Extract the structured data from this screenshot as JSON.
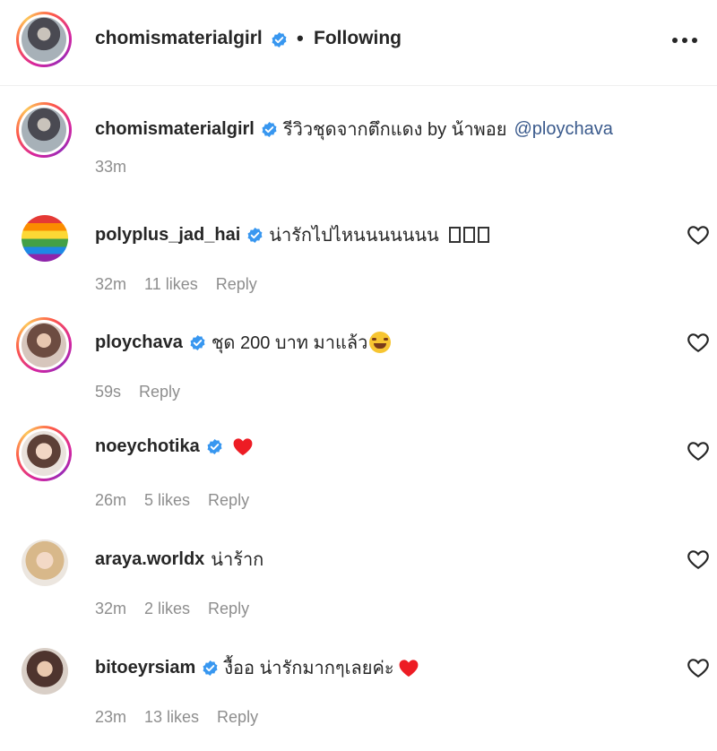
{
  "header": {
    "username": "chomismaterialgirl",
    "separator": "•",
    "follow_status": "Following"
  },
  "caption": {
    "username": "chomismaterialgirl",
    "text": "รีวิวชุดจากตึกแดง by น้าพอย",
    "mention": "@ploychava",
    "time": "33m"
  },
  "comments": [
    {
      "username": "polyplus_jad_hai",
      "verified": true,
      "text": "น่ารักไปไหนนนนนนน",
      "emoji": "tofu-glyphs",
      "time": "32m",
      "likes": "11 likes",
      "reply": "Reply"
    },
    {
      "username": "ploychava",
      "verified": true,
      "text": "ชุด 200 บาท มาแล้ว",
      "emoji": "grin-sweat-emoji",
      "time": "59s",
      "likes": "",
      "reply": "Reply"
    },
    {
      "username": "noeychotika",
      "verified": true,
      "text": "",
      "emoji": "red-heart-emoji",
      "time": "26m",
      "likes": "5 likes",
      "reply": "Reply"
    },
    {
      "username": "araya.worldx",
      "verified": false,
      "text": "น่าร้าก",
      "emoji": "",
      "time": "32m",
      "likes": "2 likes",
      "reply": "Reply"
    },
    {
      "username": "bitoeyrsiam",
      "verified": true,
      "text": "งื้ออ น่ารักมากๆเลยค่ะ",
      "emoji": "red-heart-emoji",
      "time": "23m",
      "likes": "13 likes",
      "reply": "Reply"
    }
  ],
  "colors": {
    "verified_blue": "#3897f0",
    "mention_blue": "#3a5a8c",
    "meta_gray": "#8e8e8e",
    "heart_red": "#ed1c24"
  }
}
